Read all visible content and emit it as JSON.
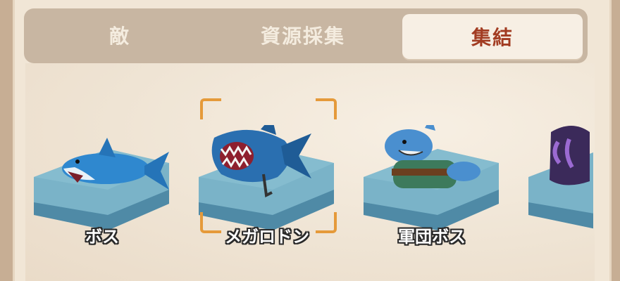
{
  "tabs": {
    "enemy_label": "敵",
    "resource_label": "資源採集",
    "rally_label": "集結"
  },
  "targets": [
    {
      "label": "ボス"
    },
    {
      "label": "メガロドン"
    },
    {
      "label": "軍団ボス"
    },
    {
      "label": ""
    }
  ],
  "colors": {
    "active_tab_text": "#a23c22",
    "inactive_tab_text": "#f4ecdf",
    "selection_bracket": "#e59a3a",
    "platform": "#6fa6bd"
  },
  "selected_index": 1
}
